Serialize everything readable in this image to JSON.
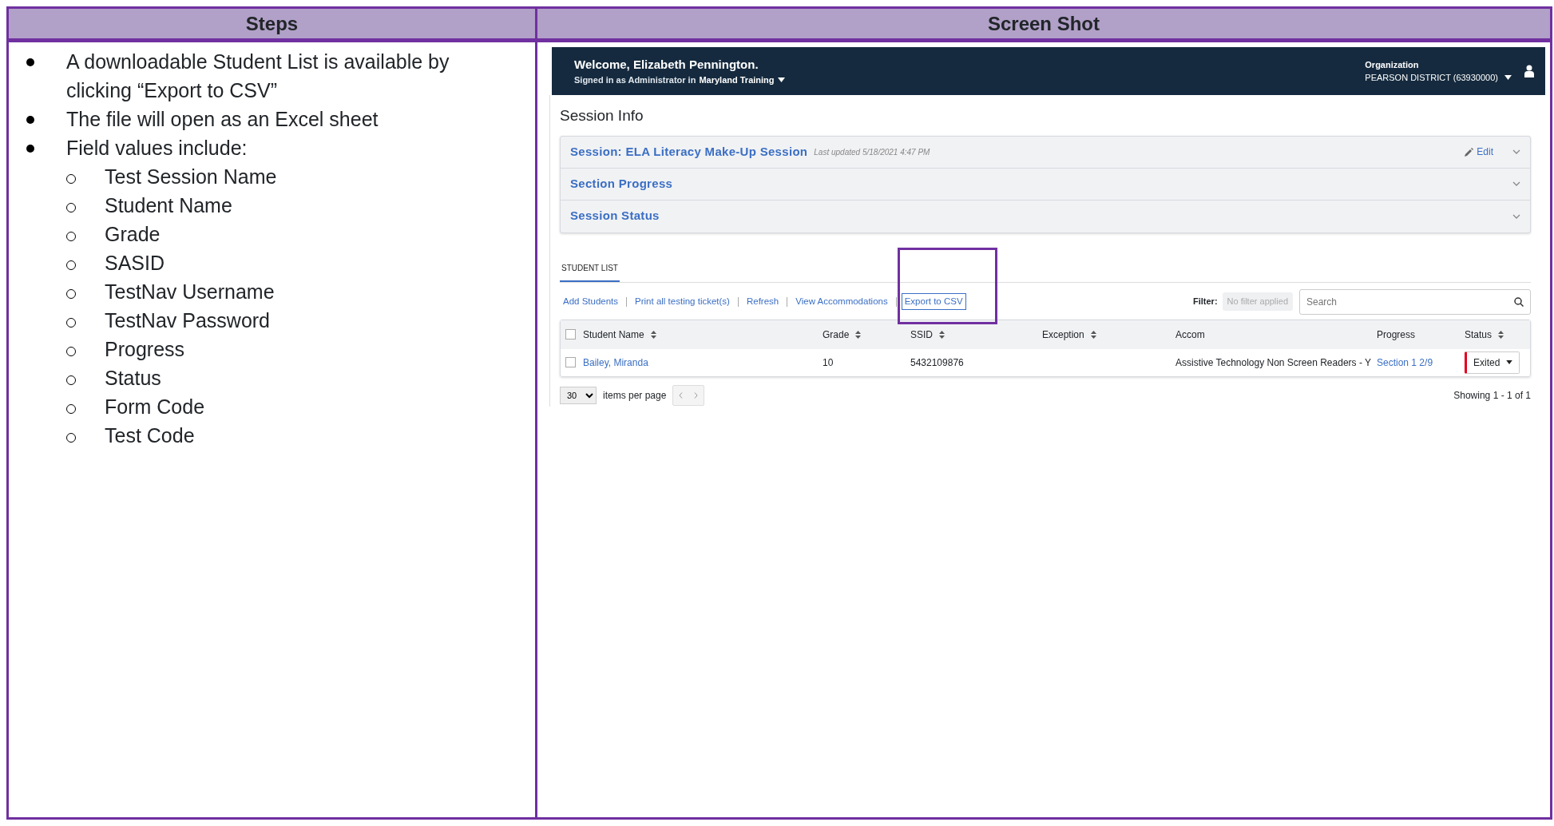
{
  "document": {
    "columns": [
      {
        "heading": "Steps"
      },
      {
        "heading": "Screen Shot"
      }
    ],
    "steps": [
      {
        "text": "A downloadable Student List is available by clicking “Export to CSV”"
      },
      {
        "text": "The file will open as an Excel sheet"
      },
      {
        "text": "Field values include:",
        "children": [
          {
            "text": "Test Session Name"
          },
          {
            "text": "Student Name"
          },
          {
            "text": "Grade"
          },
          {
            "text": "SASID"
          },
          {
            "text": "TestNav Username"
          },
          {
            "text": "TestNav Password"
          },
          {
            "text": "Progress"
          },
          {
            "text": "Status"
          },
          {
            "text": "Form Code"
          },
          {
            "text": "Test Code"
          }
        ]
      }
    ]
  },
  "screenshot": {
    "header": {
      "welcome": "Welcome, Elizabeth Pennington.",
      "signed_in": "Signed in as Administrator in",
      "training": "Maryland Training",
      "org_label": "Organization",
      "org_value": "PEARSON DISTRICT (63930000)"
    },
    "page_title": "Session Info",
    "panels": [
      {
        "title": "Session: ELA Literacy Make-Up Session",
        "subtitle": "Last updated 5/18/2021 4:47 PM",
        "action": "Edit"
      },
      {
        "title": "Section Progress"
      },
      {
        "title": "Session Status"
      }
    ],
    "tabs": [
      {
        "label": "STUDENT LIST",
        "selected": true
      }
    ],
    "toolbar": [
      {
        "label": "Add Students",
        "highlighted": false
      },
      {
        "label": "Print all testing ticket(s)",
        "highlighted": false
      },
      {
        "label": "Refresh",
        "highlighted": false
      },
      {
        "label": "View Accommodations",
        "highlighted": false
      },
      {
        "label": "Export to CSV",
        "highlighted": true
      }
    ],
    "filter": {
      "label": "Filter:",
      "value": "No filter applied"
    },
    "search": {
      "placeholder": "Search"
    },
    "table": {
      "select_all_checked": false,
      "columns": [
        {
          "label": "Student Name",
          "sortable": true
        },
        {
          "label": "Grade",
          "sortable": true
        },
        {
          "label": "SSID",
          "sortable": true
        },
        {
          "label": "Exception",
          "sortable": true
        },
        {
          "label": "Accom",
          "sortable": false
        },
        {
          "label": "Progress",
          "sortable": false
        },
        {
          "label": "Status",
          "sortable": true
        }
      ],
      "rows": [
        {
          "checked": false,
          "name": "Bailey, Miranda",
          "grade": "10",
          "ssid": "5432109876",
          "accom": "Assistive Technology Non Screen Readers - Y",
          "progress": "Section 1 2/9",
          "status": "Exited"
        }
      ]
    },
    "footer": {
      "page_size": "30",
      "items_per_page": "items per page",
      "showing": "Showing 1 - 1 of 1"
    }
  }
}
